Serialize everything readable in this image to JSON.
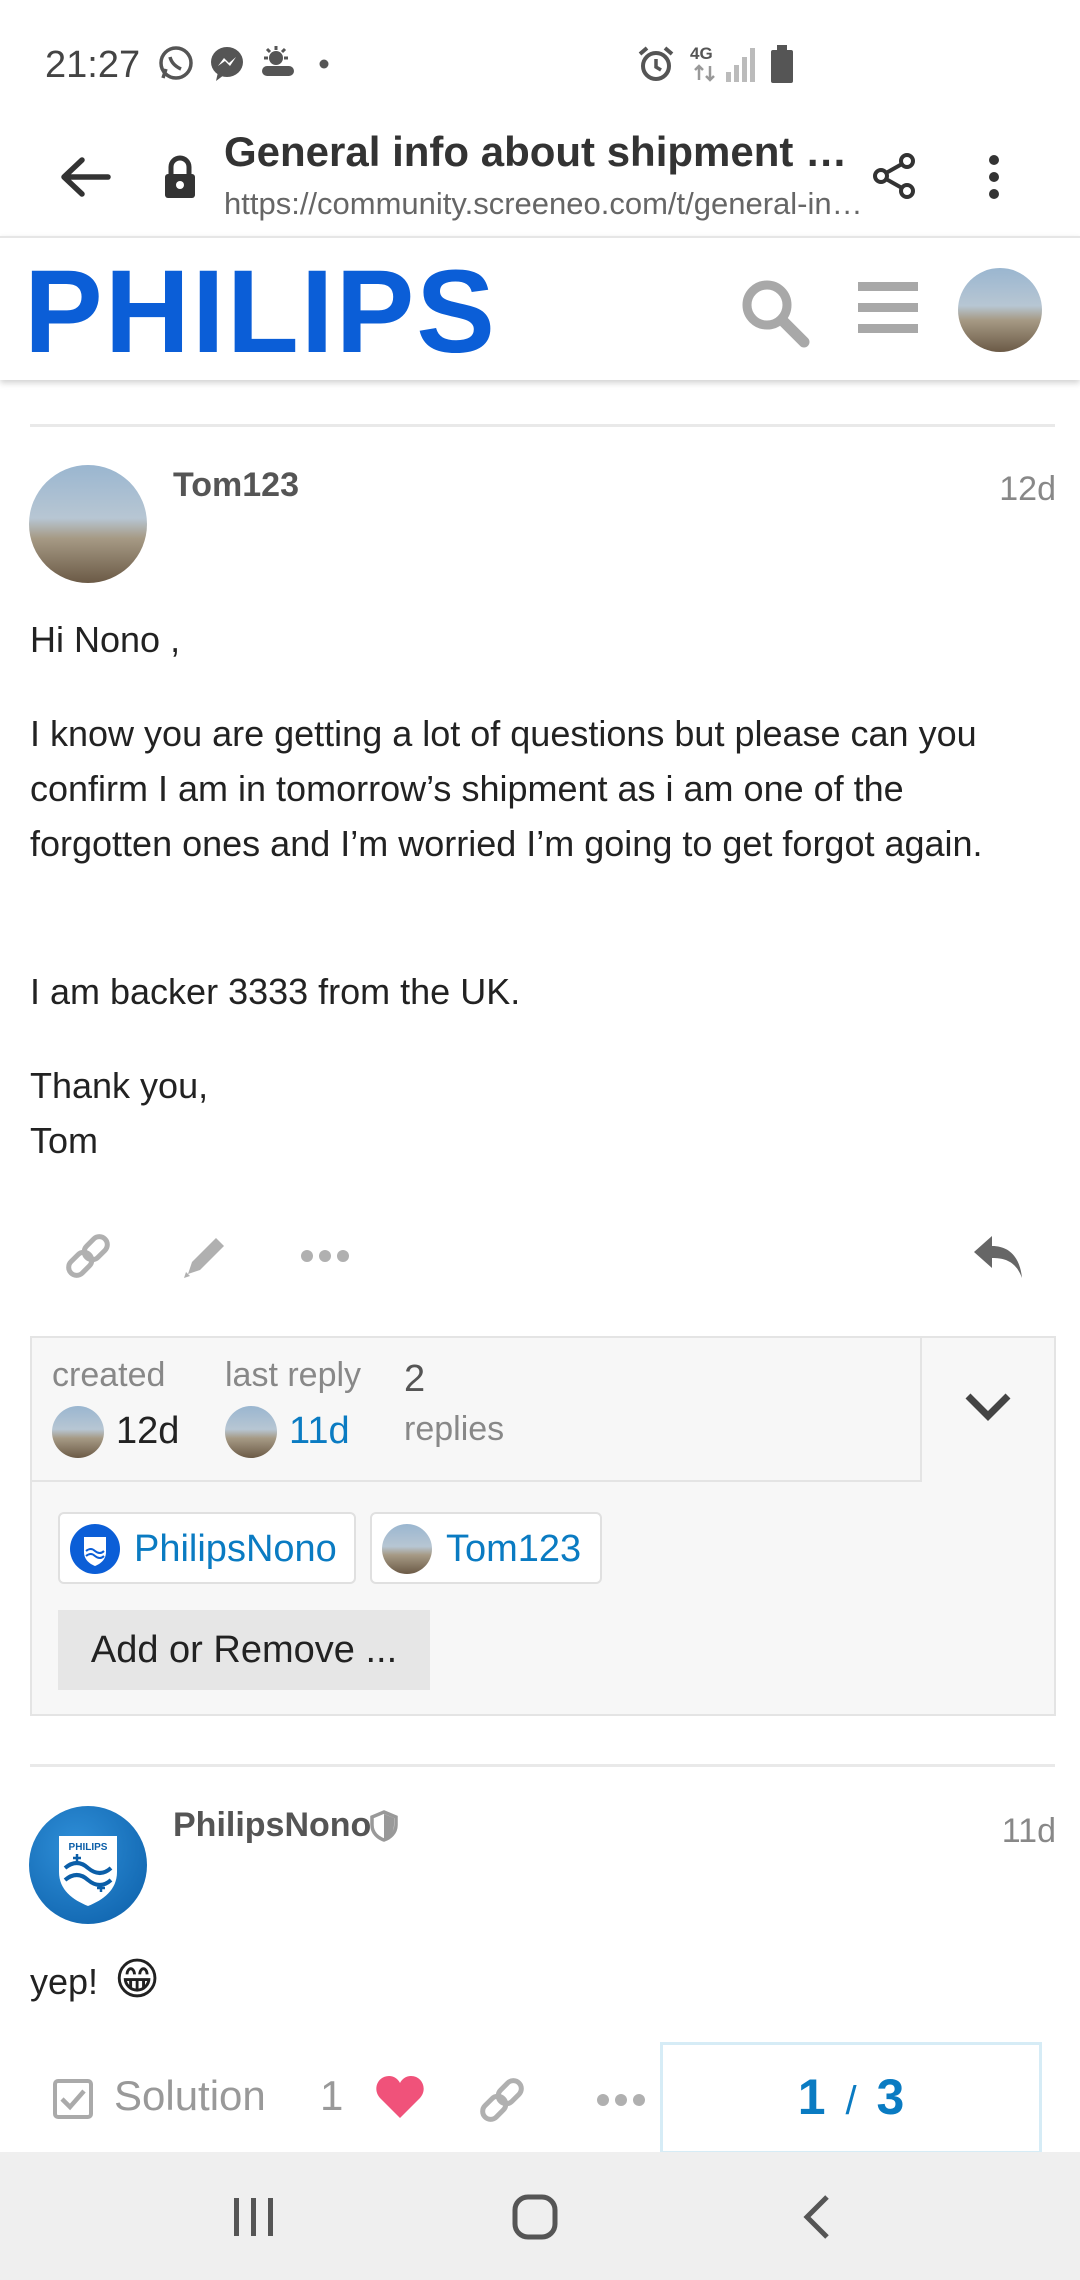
{
  "status_bar": {
    "time": "21:27",
    "left_icons": [
      "whatsapp-icon",
      "messenger-icon",
      "weather-icon",
      "dot-icon"
    ],
    "right_icons": [
      "alarm-icon",
      "4g-icon",
      "signal-icon",
      "battery-icon"
    ],
    "network": "4G"
  },
  "browser": {
    "page_title": "General info about shipment and…",
    "url": "https://community.screeneo.com/t/general-in…"
  },
  "site_header": {
    "brand": "PHILIPS",
    "brand_color": "#0b5ed7"
  },
  "posts": [
    {
      "username": "Tom123",
      "date": "12d",
      "paragraphs": [
        "Hi Nono ,",
        "I know you are getting a lot of questions but please can you confirm I am in tomorrow’s shipment as i am one of the forgotten ones and I’m worried I’m going to get forgot again.",
        "I am backer 3333 from the UK.",
        "Thank you,\nTom"
      ]
    },
    {
      "username": "PhilipsNono",
      "date": "11d",
      "text": "yep!",
      "emoji": "😁",
      "avatar_text": "PHILIPS"
    }
  ],
  "topic_map": {
    "created_label": "created",
    "created_value": "12d",
    "last_reply_label": "last reply",
    "last_reply_value": "11d",
    "replies_count": "2",
    "replies_label": "replies",
    "participants": [
      "PhilipsNono",
      "Tom123"
    ],
    "add_remove_label": "Add or Remove ..."
  },
  "post_actions": {
    "solution_label": "Solution",
    "like_count": "1"
  },
  "progress": {
    "current": "1",
    "separator": "/",
    "total": "3"
  },
  "colors": {
    "link": "#0a7bc2",
    "like": "#f0527a",
    "muted": "#999999"
  }
}
